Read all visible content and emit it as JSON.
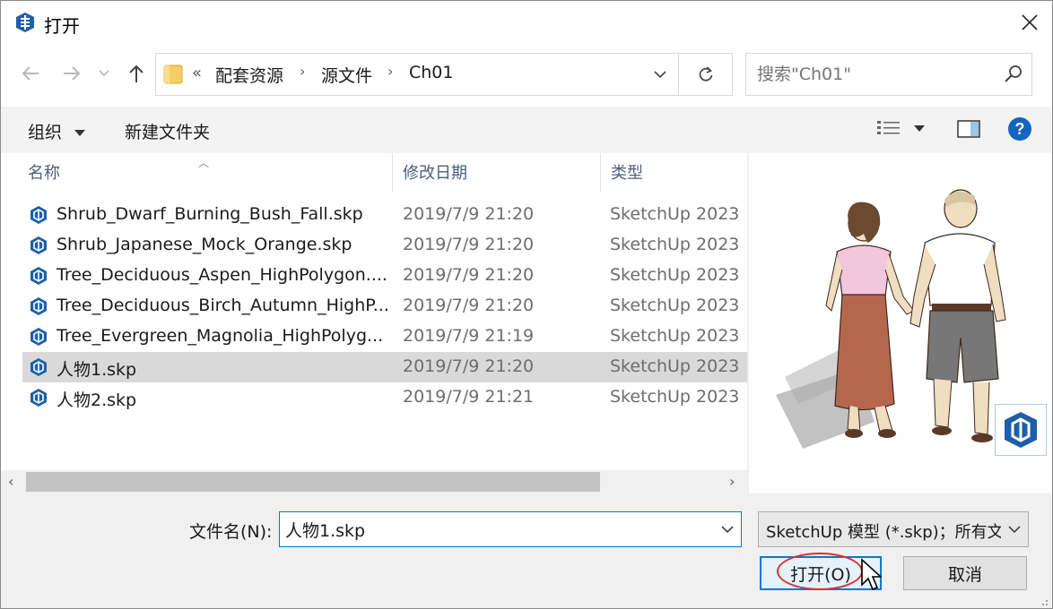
{
  "window": {
    "title": "打开",
    "icons": {
      "app": "sketchup-logo-icon",
      "close": "close-icon"
    }
  },
  "nav": {
    "icons": [
      "back-arrow-icon",
      "forward-arrow-icon",
      "recent-locations-chevron-icon",
      "up-arrow-icon"
    ]
  },
  "address": {
    "overflow": "«",
    "crumbs": [
      "配套资源",
      "源文件",
      "Ch01"
    ],
    "separator": "›",
    "icons": {
      "folder": "folder-icon",
      "dropdown": "chevron-down-icon",
      "refresh": "refresh-icon"
    }
  },
  "search": {
    "placeholder": "搜索\"Ch01\"",
    "icon": "search-icon"
  },
  "toolbar": {
    "organize_label": "组织",
    "new_folder_label": "新建文件夹",
    "icons": {
      "view": "view-details-icon",
      "view_dropdown": "caret-down-icon",
      "preview_pane": "preview-pane-icon",
      "help": "help-icon"
    }
  },
  "columns": {
    "name": "名称",
    "date": "修改日期",
    "type": "类型"
  },
  "files": [
    {
      "name": "Shrub_Dwarf_Burning_Bush_Fall.skp",
      "date": "2019/7/9 21:20",
      "type": "SketchUp 2023",
      "selected": false
    },
    {
      "name": "Shrub_Japanese_Mock_Orange.skp",
      "date": "2019/7/9 21:20",
      "type": "SketchUp 2023",
      "selected": false
    },
    {
      "name": "Tree_Deciduous_Aspen_HighPolygon....",
      "date": "2019/7/9 21:20",
      "type": "SketchUp 2023",
      "selected": false
    },
    {
      "name": "Tree_Deciduous_Birch_Autumn_HighP...",
      "date": "2019/7/9 21:20",
      "type": "SketchUp 2023",
      "selected": false
    },
    {
      "name": "Tree_Evergreen_Magnolia_HighPolyg...",
      "date": "2019/7/9 21:19",
      "type": "SketchUp 2023",
      "selected": false
    },
    {
      "name": "人物1.skp",
      "date": "2019/7/9 21:20",
      "type": "SketchUp 2023",
      "selected": true
    },
    {
      "name": "人物2.skp",
      "date": "2019/7/9 21:21",
      "type": "SketchUp 2023",
      "selected": false
    }
  ],
  "preview": {
    "description_icon": "sketchup-badge-icon"
  },
  "filename": {
    "label": "文件名(N):",
    "value": "人物1.skp"
  },
  "filetype": {
    "value": "SketchUp 模型 (*.skp)；所有文"
  },
  "buttons": {
    "open": "打开(O)",
    "cancel": "取消"
  },
  "colors": {
    "accent": "#0078d7",
    "selection": "#d9d9d9",
    "annotation_ring": "#e0312e",
    "sketchup_blue": "#1d5fa8"
  }
}
